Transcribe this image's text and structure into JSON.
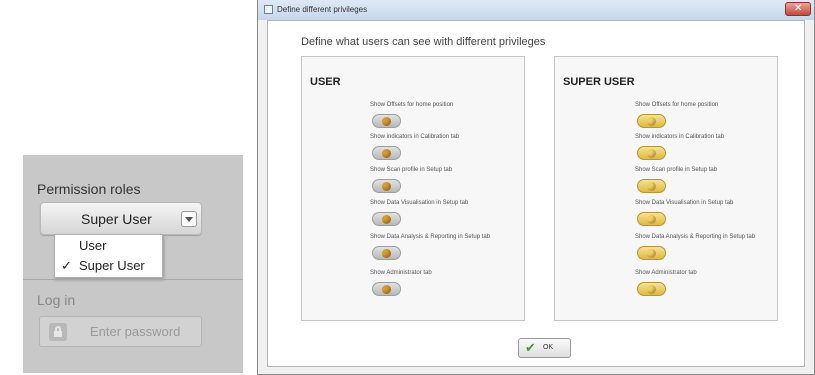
{
  "permission_panel": {
    "title": "Permission roles",
    "selected_role": "Super User",
    "dropdown_options": [
      {
        "label": "User",
        "checked": false
      },
      {
        "label": "Super User",
        "checked": true
      }
    ],
    "check_mark": "✓",
    "login_title": "Log in",
    "password_placeholder": "Enter password"
  },
  "dialog": {
    "title": "Define different privileges",
    "close_glyph": "✕",
    "heading": "Define what users can see with different privileges",
    "ok_label": "OK",
    "ok_check": "✔",
    "groups": [
      {
        "title": "USER",
        "options": [
          {
            "label": "Show Offsets for home position",
            "enabled": false
          },
          {
            "label": "Show indicators in Calibration tab",
            "enabled": false
          },
          {
            "label": "Show Scan profile in Setup tab",
            "enabled": false
          },
          {
            "label": "Show Data Visualisation in Setup tab",
            "enabled": false
          },
          {
            "label": "Show Data Analysis & Reporting in Setup tab",
            "enabled": false
          },
          {
            "label": "Show Administrator tab",
            "enabled": false
          }
        ]
      },
      {
        "title": "SUPER USER",
        "options": [
          {
            "label": "Show Offsets for home position",
            "enabled": true
          },
          {
            "label": "Show indicators in Calibration tab",
            "enabled": true
          },
          {
            "label": "Show Scan profile in Setup tab",
            "enabled": true
          },
          {
            "label": "Show Data Visualisation in Setup tab",
            "enabled": true
          },
          {
            "label": "Show Data Analysis & Reporting in Setup tab",
            "enabled": true
          },
          {
            "label": "Show Administrator tab",
            "enabled": true
          }
        ]
      }
    ]
  }
}
